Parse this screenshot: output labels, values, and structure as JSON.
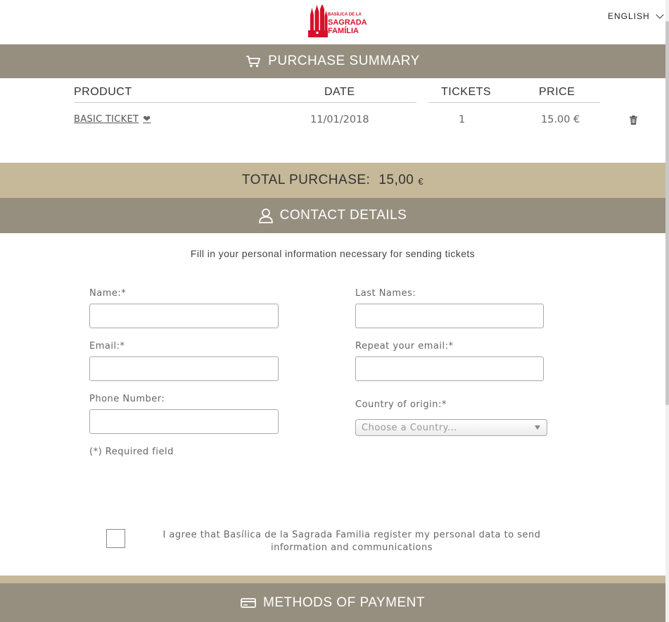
{
  "header": {
    "logo_lines": [
      "BASÍLICA DE LA",
      "SAGRADA",
      "FAMÍLIA"
    ],
    "language": "ENGLISH"
  },
  "summary": {
    "title": "PURCHASE SUMMARY",
    "columns": [
      "PRODUCT",
      "DATE",
      "TICKETS",
      "PRICE"
    ],
    "rows": [
      {
        "product": "BASIC TICKET",
        "date": "11/01/2018",
        "tickets": "1",
        "price": "15.00 €"
      }
    ]
  },
  "total": {
    "label": "TOTAL PURCHASE:",
    "amount": "15,00",
    "currency": "€"
  },
  "contact": {
    "title": "CONTACT DETAILS",
    "intro": "Fill in your personal information necessary for sending tickets",
    "name_label": "Name:*",
    "last_names_label": "Last Names:",
    "email_label": "Email:*",
    "repeat_email_label": "Repeat your email:*",
    "phone_label": "Phone Number:",
    "country_label": "Country of origin:*",
    "country_placeholder": "Choose a Country...",
    "required_note": "(*) Required field",
    "consent": "I agree that Basílica de la Sagrada Familia register my personal data to send information and communications"
  },
  "payment": {
    "title": "METHODS OF PAYMENT"
  },
  "colors": {
    "band_dark": "#968f7f",
    "band_light": "#c5b99a",
    "brand_red": "#d7102a"
  }
}
